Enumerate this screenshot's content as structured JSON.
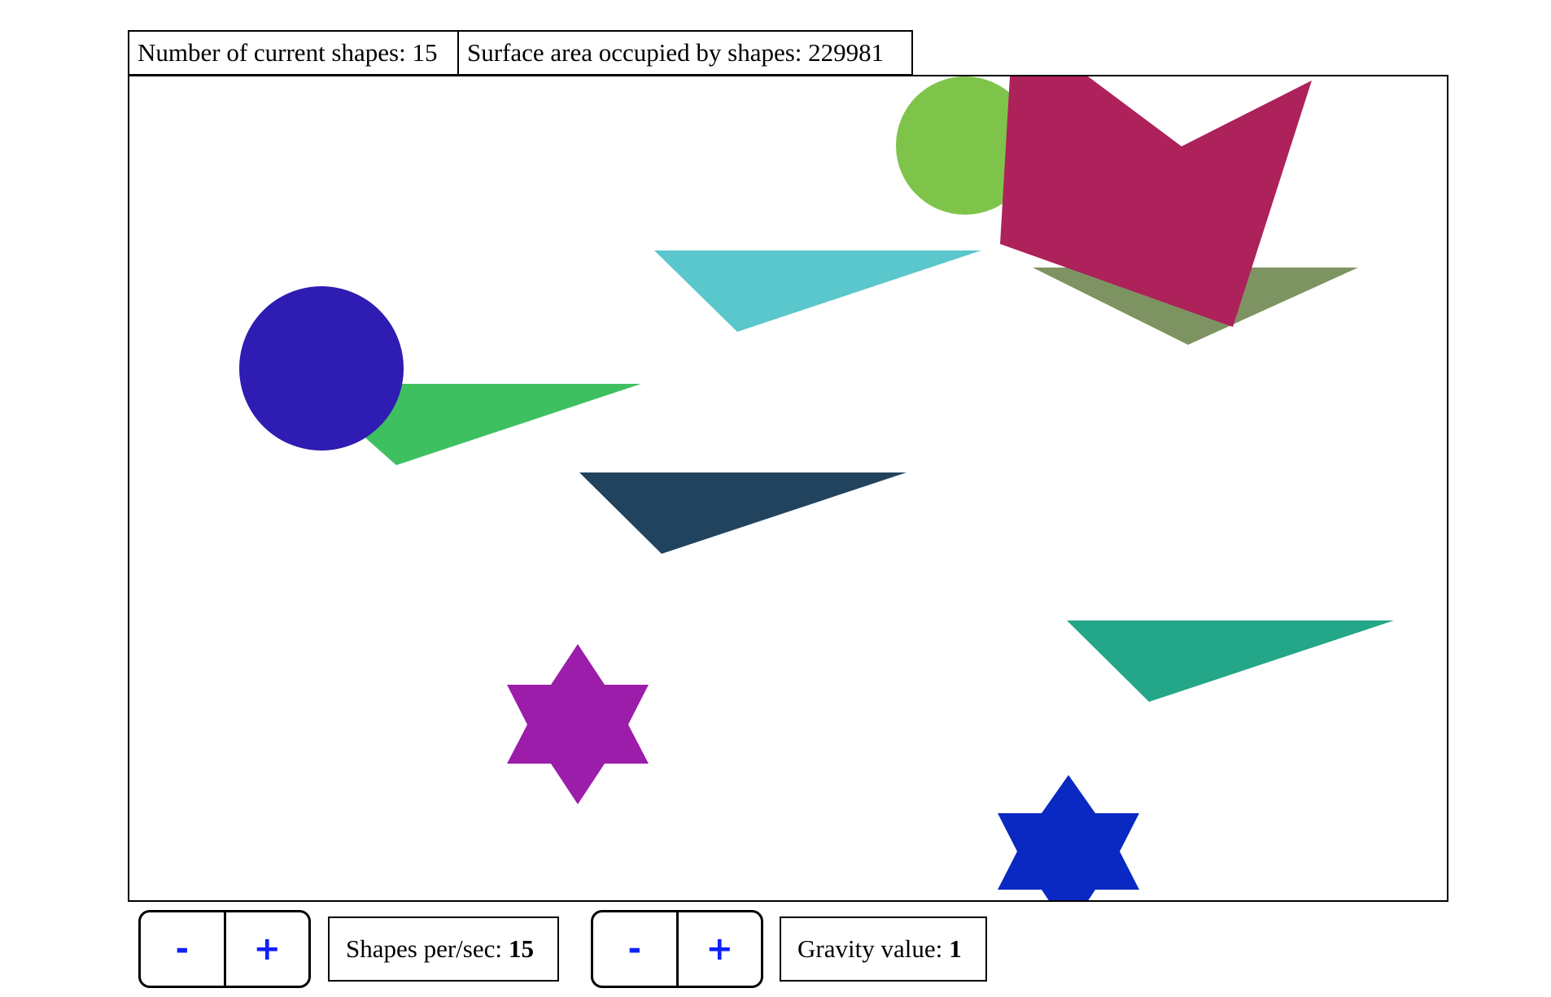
{
  "header": {
    "shape_count_label": "Number of current shapes: 15",
    "surface_area_label": "Surface area occupied by shapes: 229981"
  },
  "canvas": {
    "background": "#ffffff",
    "shapes": [
      {
        "type": "circle",
        "color": "#7ec44b"
      },
      {
        "type": "triangle",
        "color": "#7d9462"
      },
      {
        "type": "pentagon",
        "color": "#ad225a"
      },
      {
        "type": "triangle",
        "color": "#59c7cb"
      },
      {
        "type": "triangle",
        "color": "#3ec061"
      },
      {
        "type": "circle",
        "color": "#2e1cb3"
      },
      {
        "type": "triangle",
        "color": "#22435d"
      },
      {
        "type": "triangle",
        "color": "#24a688"
      },
      {
        "type": "star",
        "color": "#9b1daa"
      },
      {
        "type": "star",
        "color": "#0a28c2"
      }
    ]
  },
  "controls": {
    "rate": {
      "decrement_label": "-",
      "increment_label": "+",
      "label": "Shapes per/sec:",
      "value": "15"
    },
    "gravity": {
      "decrement_label": "-",
      "increment_label": "+",
      "label": "Gravity value:",
      "value": "1"
    }
  }
}
